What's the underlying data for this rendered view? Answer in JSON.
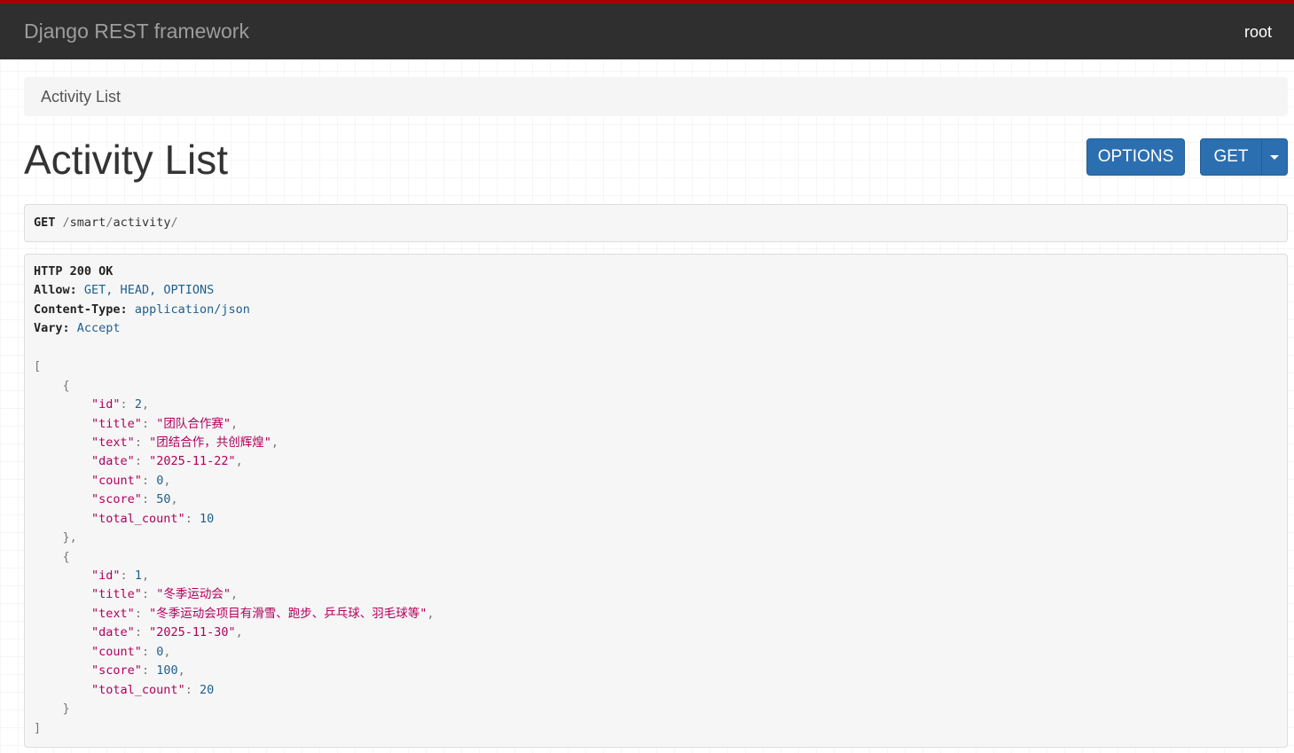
{
  "navbar": {
    "brand": "Django REST framework",
    "user": "root"
  },
  "breadcrumb": {
    "current": "Activity List"
  },
  "page": {
    "title": "Activity List"
  },
  "buttons": {
    "options": "OPTIONS",
    "get": "GET"
  },
  "request": {
    "method": "GET",
    "path_parts": [
      "smart",
      "activity"
    ]
  },
  "response": {
    "status": "HTTP 200 OK",
    "headers": [
      {
        "name": "Allow:",
        "value": "GET, HEAD, OPTIONS"
      },
      {
        "name": "Content-Type:",
        "value": "application/json"
      },
      {
        "name": "Vary:",
        "value": "Accept"
      }
    ],
    "items": [
      {
        "id": "2",
        "title": "团队合作赛",
        "text": "团结合作，共创辉煌",
        "date": "2025-11-22",
        "count": "0",
        "score": "50",
        "total_count": "10"
      },
      {
        "id": "1",
        "title": "冬季运动会",
        "text": "冬季运动会项目有滑雪、跑步、乒乓球、羽毛球等",
        "date": "2025-11-30",
        "count": "0",
        "score": "100",
        "total_count": "20"
      }
    ]
  },
  "colors": {
    "navbar_bg": "#2f2f2f",
    "navbar_top_border": "#a30000",
    "button_primary": "#2c6fb0",
    "json_key": "#b0005a",
    "json_number": "#1f5f8b"
  }
}
